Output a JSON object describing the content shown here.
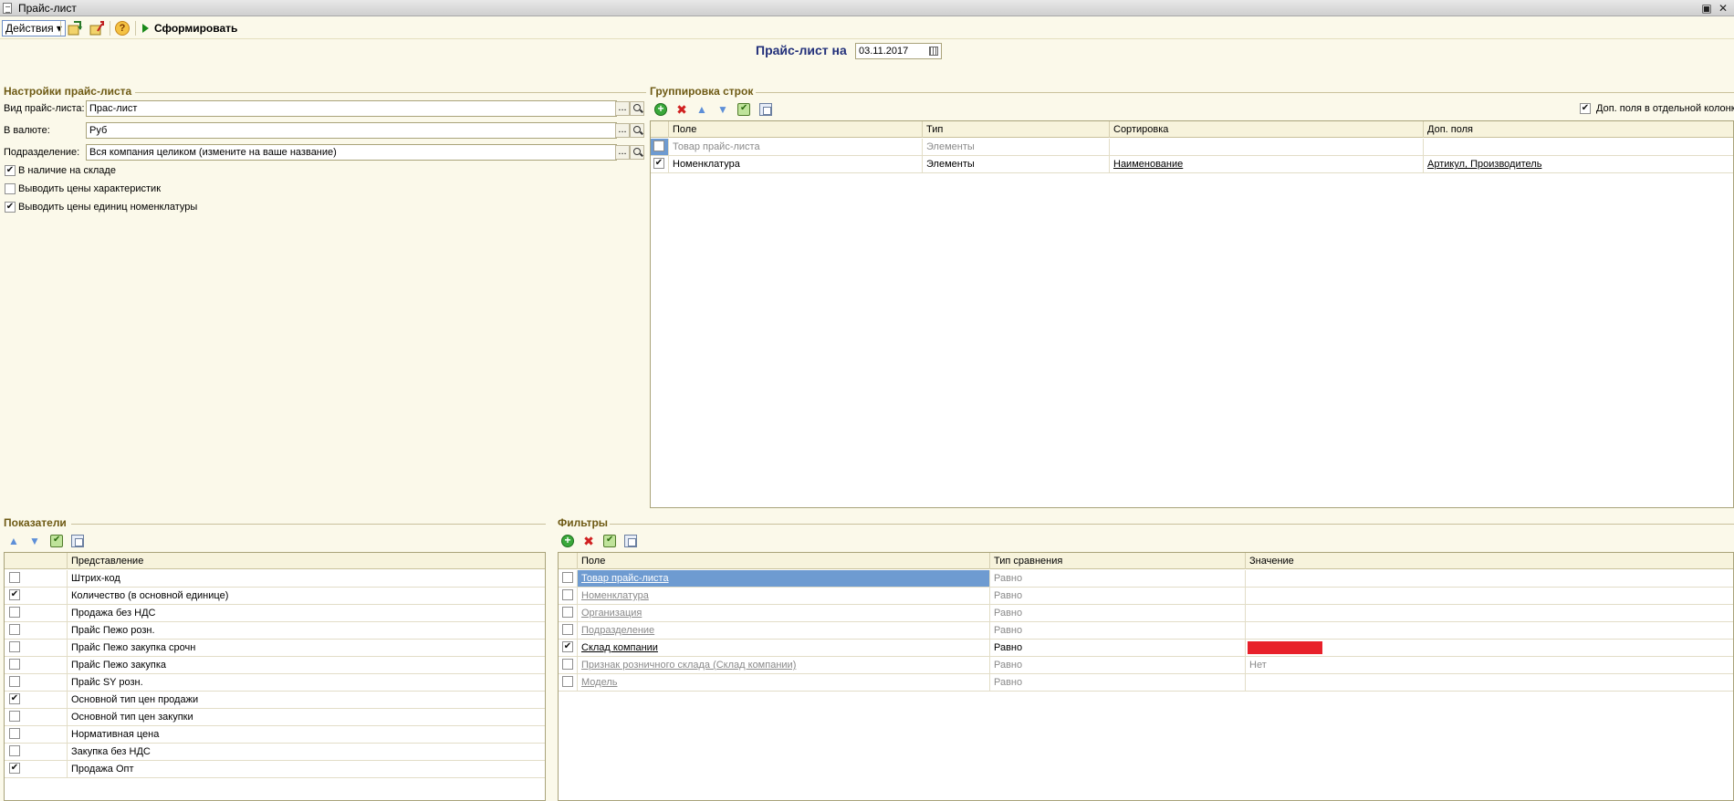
{
  "window": {
    "title": "Прайс-лист"
  },
  "toolbar": {
    "actions_label": "Действия ▾",
    "generate_label": "Сформировать",
    "help_label": "?"
  },
  "header": {
    "label": "Прайс-лист на",
    "date": "03.11.2017"
  },
  "settings": {
    "title": "Настройки прайс-листа",
    "fields": [
      {
        "label": "Вид прайс-листа:",
        "value": "Прас-лист"
      },
      {
        "label": "В валюте:",
        "value": "Руб"
      },
      {
        "label": "Подразделение:",
        "value": "Вся компания целиком (измените на ваше название)"
      }
    ],
    "select_btn": "...",
    "checkboxes": [
      {
        "label": "В наличие на складе",
        "checked": true
      },
      {
        "label": "Выводить цены характеристик",
        "checked": false
      },
      {
        "label": "Выводить цены единиц номенклатуры",
        "checked": true
      }
    ]
  },
  "grouping": {
    "title": "Группировка строк",
    "extra_fields_checkbox": {
      "label": "Доп. поля в отдельной колонке",
      "checked": true
    },
    "columns": [
      "Поле",
      "Тип",
      "Сортировка",
      "Доп. поля"
    ],
    "rows": [
      {
        "checked": false,
        "field": "Товар прайс-листа",
        "type": "Элементы",
        "sort": "",
        "extra": "",
        "dim": true
      },
      {
        "checked": true,
        "field": "Номенклатура",
        "type": "Элементы",
        "sort": "Наименование",
        "extra": "Артикул, Производитель",
        "dim": false
      }
    ]
  },
  "indicators": {
    "title": "Показатели",
    "column": "Представление",
    "rows": [
      {
        "checked": false,
        "label": "Штрих-код"
      },
      {
        "checked": true,
        "label": "Количество (в основной единице)"
      },
      {
        "checked": false,
        "label": "Продажа без НДС"
      },
      {
        "checked": false,
        "label": "Прайс Пежо розн."
      },
      {
        "checked": false,
        "label": "Прайс Пежо закупка срочн"
      },
      {
        "checked": false,
        "label": "Прайс Пежо закупка"
      },
      {
        "checked": false,
        "label": "Прайс SY розн."
      },
      {
        "checked": true,
        "label": "Основной тип цен продажи"
      },
      {
        "checked": false,
        "label": "Основной тип цен закупки"
      },
      {
        "checked": false,
        "label": "Нормативная цена"
      },
      {
        "checked": false,
        "label": "Закупка без НДС"
      },
      {
        "checked": true,
        "label": "Продажа Опт"
      }
    ]
  },
  "filters": {
    "title": "Фильтры",
    "columns": [
      "Поле",
      "Тип сравнения",
      "Значение"
    ],
    "rows": [
      {
        "checked": false,
        "field": "Товар прайс-листа",
        "compare": "Равно",
        "value": "",
        "dim": true,
        "selected": true
      },
      {
        "checked": false,
        "field": "Номенклатура",
        "compare": "Равно",
        "value": "",
        "dim": true
      },
      {
        "checked": false,
        "field": "Организация",
        "compare": "Равно",
        "value": "",
        "dim": true
      },
      {
        "checked": false,
        "field": "Подразделение",
        "compare": "Равно",
        "value": "",
        "dim": true
      },
      {
        "checked": true,
        "field": "Склад компании",
        "compare": "Равно",
        "value": "",
        "dim": false,
        "value_color": "#e8202a"
      },
      {
        "checked": false,
        "field": "Признак розничного склада (Склад компании)",
        "compare": "Равно",
        "value": "Нет",
        "dim": true
      },
      {
        "checked": false,
        "field": "Модель",
        "compare": "Равно",
        "value": "",
        "dim": true
      }
    ]
  }
}
